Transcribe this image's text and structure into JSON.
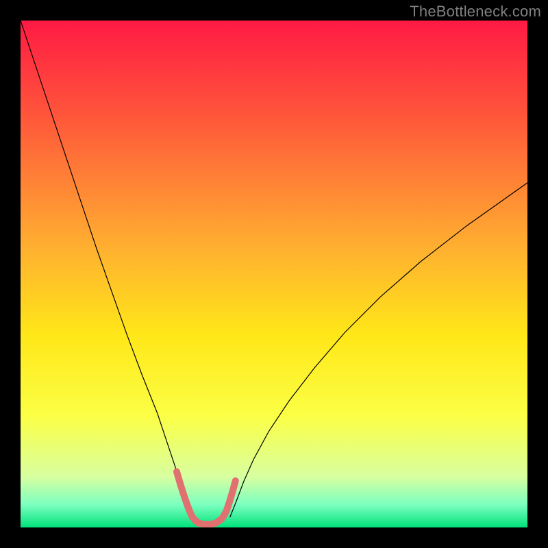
{
  "watermark": "TheBottleneck.com",
  "chart_data": {
    "type": "line",
    "title": "",
    "xlabel": "",
    "ylabel": "",
    "xlim": [
      0,
      100
    ],
    "ylim": [
      0,
      100
    ],
    "grid": false,
    "legend": false,
    "background_gradient": {
      "stops": [
        {
          "offset": 0.0,
          "color": "#ff1a44"
        },
        {
          "offset": 0.2,
          "color": "#ff5a3a"
        },
        {
          "offset": 0.45,
          "color": "#ffb030"
        },
        {
          "offset": 0.62,
          "color": "#ffe718"
        },
        {
          "offset": 0.78,
          "color": "#fbff45"
        },
        {
          "offset": 0.9,
          "color": "#d8ffa0"
        },
        {
          "offset": 0.955,
          "color": "#7cffc0"
        },
        {
          "offset": 1.0,
          "color": "#00e27a"
        }
      ]
    },
    "series": [
      {
        "name": "left-branch",
        "color": "#000000",
        "width": 1.2,
        "x": [
          0.0,
          3.0,
          6.0,
          9.0,
          12.0,
          15.0,
          18.0,
          21.0,
          24.0,
          27.0,
          29.0,
          30.5,
          32.0,
          33.0,
          33.8
        ],
        "y": [
          100.0,
          91.0,
          82.0,
          73.0,
          64.0,
          55.0,
          46.5,
          38.0,
          30.0,
          22.5,
          16.5,
          12.0,
          8.0,
          4.5,
          2.0
        ]
      },
      {
        "name": "right-branch",
        "color": "#000000",
        "width": 1.2,
        "x": [
          41.3,
          42.5,
          44.0,
          46.0,
          49.0,
          53.0,
          58.0,
          64.0,
          71.0,
          79.0,
          88.0,
          100.0
        ],
        "y": [
          2.0,
          5.0,
          9.0,
          13.5,
          19.0,
          25.0,
          31.5,
          38.5,
          45.5,
          52.5,
          59.5,
          68.0
        ]
      },
      {
        "name": "highlight-band",
        "color": "#e17070",
        "width": 10,
        "cap": "round",
        "x": [
          30.8,
          31.6,
          32.4,
          33.2,
          33.9,
          35.0,
          36.2,
          37.4,
          38.6,
          39.8,
          40.6,
          41.2,
          41.8,
          42.4
        ],
        "y": [
          11.0,
          8.3,
          5.8,
          3.6,
          2.0,
          0.9,
          0.6,
          0.6,
          0.9,
          1.8,
          3.2,
          5.0,
          7.0,
          9.2
        ]
      }
    ]
  }
}
